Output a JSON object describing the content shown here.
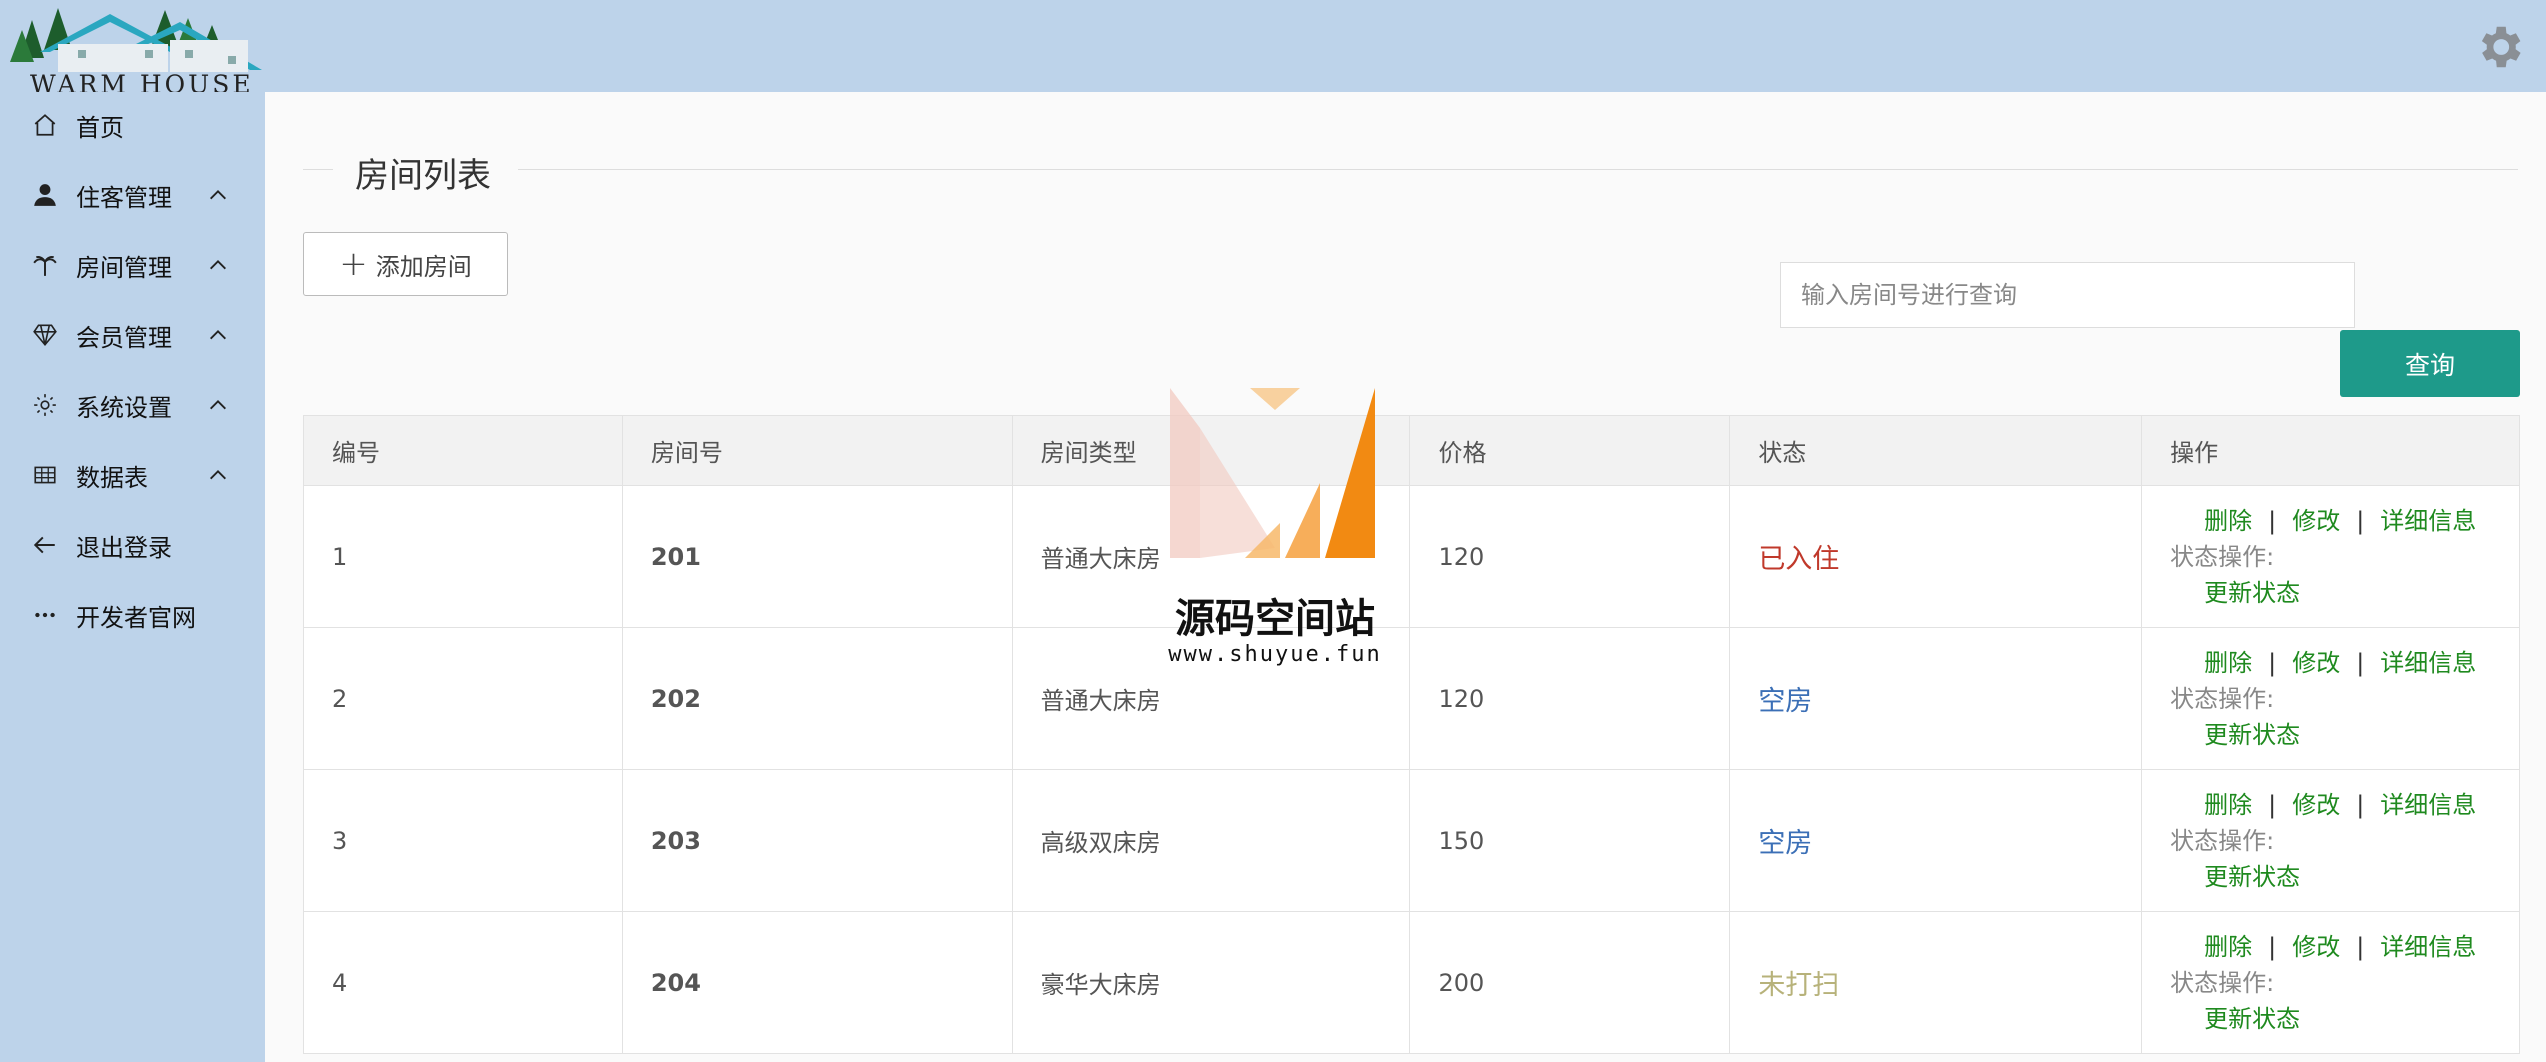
{
  "brand": {
    "logo_text": "WARM HOUSE"
  },
  "sidebar": {
    "items": [
      {
        "label": "首页",
        "icon": "home-icon",
        "has_chevron": false
      },
      {
        "label": "住客管理",
        "icon": "user-icon",
        "has_chevron": true
      },
      {
        "label": "房间管理",
        "icon": "palm-icon",
        "has_chevron": true
      },
      {
        "label": "会员管理",
        "icon": "diamond-icon",
        "has_chevron": true
      },
      {
        "label": "系统设置",
        "icon": "gear-icon",
        "has_chevron": true
      },
      {
        "label": "数据表",
        "icon": "table-icon",
        "has_chevron": true
      },
      {
        "label": "退出登录",
        "icon": "arrow-left-icon",
        "has_chevron": false
      },
      {
        "label": "开发者官网",
        "icon": "more-icon",
        "has_chevron": false
      }
    ]
  },
  "main": {
    "title": "房间列表",
    "add_button": "添加房间",
    "search": {
      "placeholder": "输入房间号进行查询",
      "value": ""
    },
    "query_button": "查询",
    "table": {
      "headers": [
        "编号",
        "房间号",
        "房间类型",
        "价格",
        "状态",
        "操作"
      ],
      "rows": [
        {
          "id": "1",
          "room": "201",
          "type": "普通大床房",
          "price": "120",
          "status": "已入住",
          "status_kind": "occupied"
        },
        {
          "id": "2",
          "room": "202",
          "type": "普通大床房",
          "price": "120",
          "status": "空房",
          "status_kind": "empty"
        },
        {
          "id": "3",
          "room": "203",
          "type": "高级双床房",
          "price": "150",
          "status": "空房",
          "status_kind": "empty"
        },
        {
          "id": "4",
          "room": "204",
          "type": "豪华大床房",
          "price": "200",
          "status": "未打扫",
          "status_kind": "dirty"
        }
      ],
      "actions": {
        "delete": "删除",
        "edit": "修改",
        "detail": "详细信息",
        "separator": "|",
        "state_label": "状态操作:",
        "update_state": "更新状态"
      }
    }
  },
  "watermark": {
    "title": "源码空间站",
    "url": "www.shuyue.fun"
  },
  "colors": {
    "sidebar_bg": "#bdd3ea",
    "query_button": "#1e9a8a",
    "status_occupied": "#c0392b",
    "status_empty": "#3b6fb6",
    "status_dirty": "#b7b27a",
    "action_link": "#1f8a1f"
  }
}
